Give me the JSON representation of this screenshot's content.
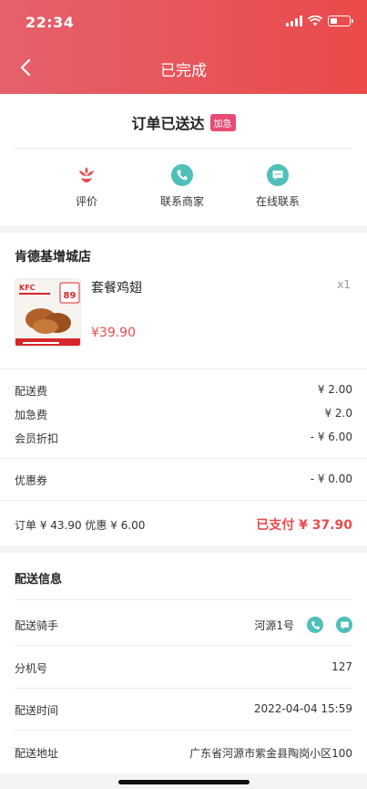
{
  "status_bar": {
    "time": "22:34",
    "battery_level": 0.35
  },
  "nav": {
    "title": "已完成",
    "back_icon": "chevron-left-icon"
  },
  "order_status": {
    "title": "订单已送达",
    "badge": "加急"
  },
  "actions": [
    {
      "label": "评价",
      "icon": "flower-icon",
      "color": "#e94c4c"
    },
    {
      "label": "联系商家",
      "icon": "phone-icon",
      "color": "#4fbfba"
    },
    {
      "label": "在线联系",
      "icon": "chat-icon",
      "color": "#4fbfba"
    }
  ],
  "store": {
    "name": "肯德基增城店",
    "product": {
      "name": "套餐鸡翅",
      "qty": "x1",
      "price": "¥39.90",
      "image_logo": "KFC",
      "image_price": "89"
    }
  },
  "fees": [
    {
      "label": "配送费",
      "value": "¥ 2.00"
    },
    {
      "label": "加急费",
      "value": "¥ 2.0"
    },
    {
      "label": "会员折扣",
      "value": "- ¥ 6.00"
    }
  ],
  "coupon": {
    "label": "优惠券",
    "value": "- ¥ 0.00"
  },
  "summary": {
    "text": "订单 ¥ 43.90 优惠 ¥ 6.00",
    "paid": "已支付 ¥ 37.90"
  },
  "delivery": {
    "title": "配送信息",
    "rider_label": "配送骑手",
    "rider_value": "河源1号",
    "ext_label": "分机号",
    "ext_value": "127",
    "time_label": "配送时间",
    "time_value": "2022-04-04 15:59",
    "addr_label": "配送地址",
    "addr_value": "广东省河源市紫金县陶岗小区100"
  },
  "colors": {
    "accent": "#e94c4c",
    "teal": "#4fbfba",
    "badge": "#e84b74"
  }
}
